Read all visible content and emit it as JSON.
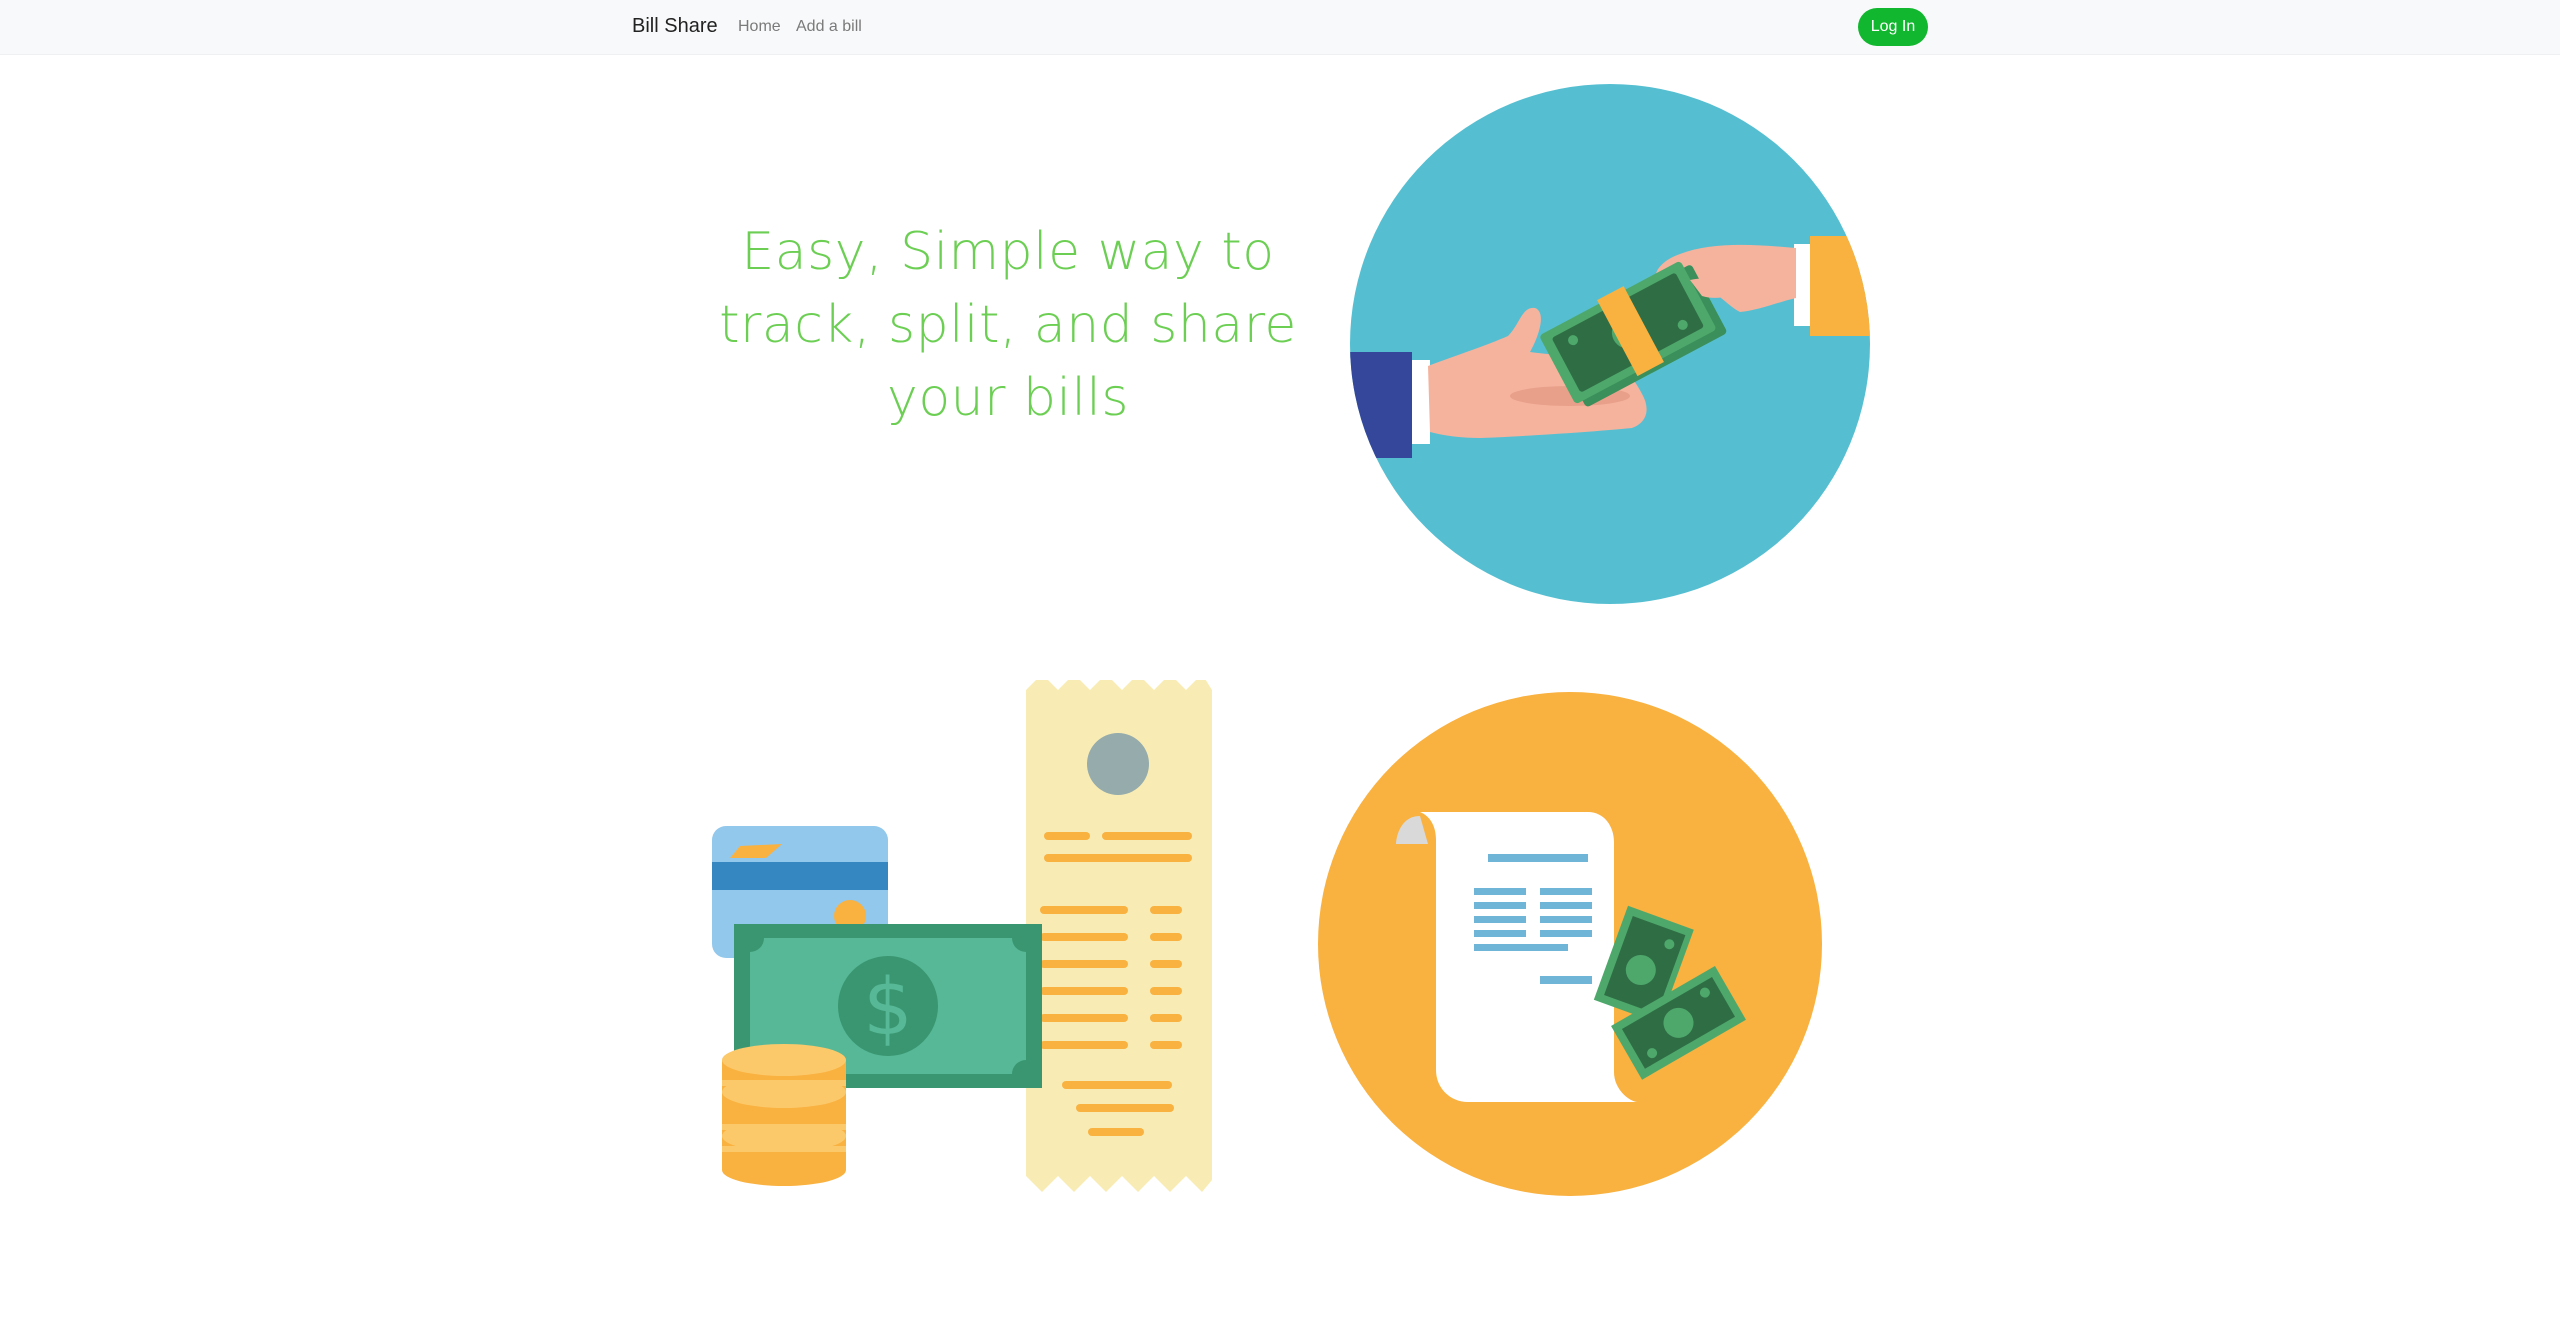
{
  "navbar": {
    "brand": "Bill Share",
    "links": [
      "Home",
      "Add a bill"
    ],
    "login_label": "Log In"
  },
  "hero": {
    "text": "Easy, Simple way to track, split, and share your bills"
  },
  "illustrations": [
    {
      "name": "money-handover-illustration"
    },
    {
      "name": "payment-items-illustration"
    },
    {
      "name": "receipt-cash-illustration"
    }
  ],
  "colors": {
    "navbar_bg": "#f8f9fa",
    "accent_green": "#6ccf54",
    "login_green": "#11b72e",
    "teal_circle": "#55bfd1",
    "orange_circle": "#f9b140"
  }
}
